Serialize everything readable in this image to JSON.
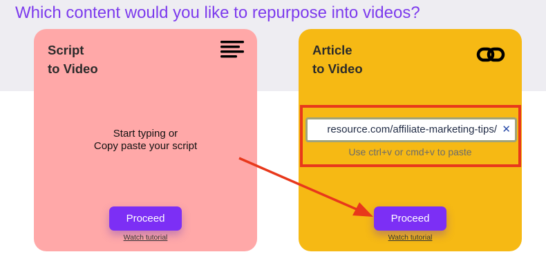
{
  "heading": "Which content would you like to repurpose into videos?",
  "script_card": {
    "title_line1": "Script",
    "title_line2": "to Video",
    "icon": "menu-lines-icon",
    "hint_line1": "Start typing or",
    "hint_line2": "Copy paste your script",
    "proceed_label": "Proceed",
    "tutorial_label": "Watch tutorial",
    "background": "#ffa8a8"
  },
  "article_card": {
    "title_line1": "Article",
    "title_line2": "to Video",
    "icon": "link-icon",
    "url_value": "resource.com/affiliate-marketing-tips/",
    "clear_glyph": "✕",
    "paste_hint": "Use ctrl+v or cmd+v to paste",
    "proceed_label": "Proceed",
    "tutorial_label": "Watch tutorial",
    "background": "#f6b914"
  },
  "colors": {
    "accent": "#7c2ff5",
    "heading": "#7c3aed",
    "annotation": "#e8381b"
  }
}
